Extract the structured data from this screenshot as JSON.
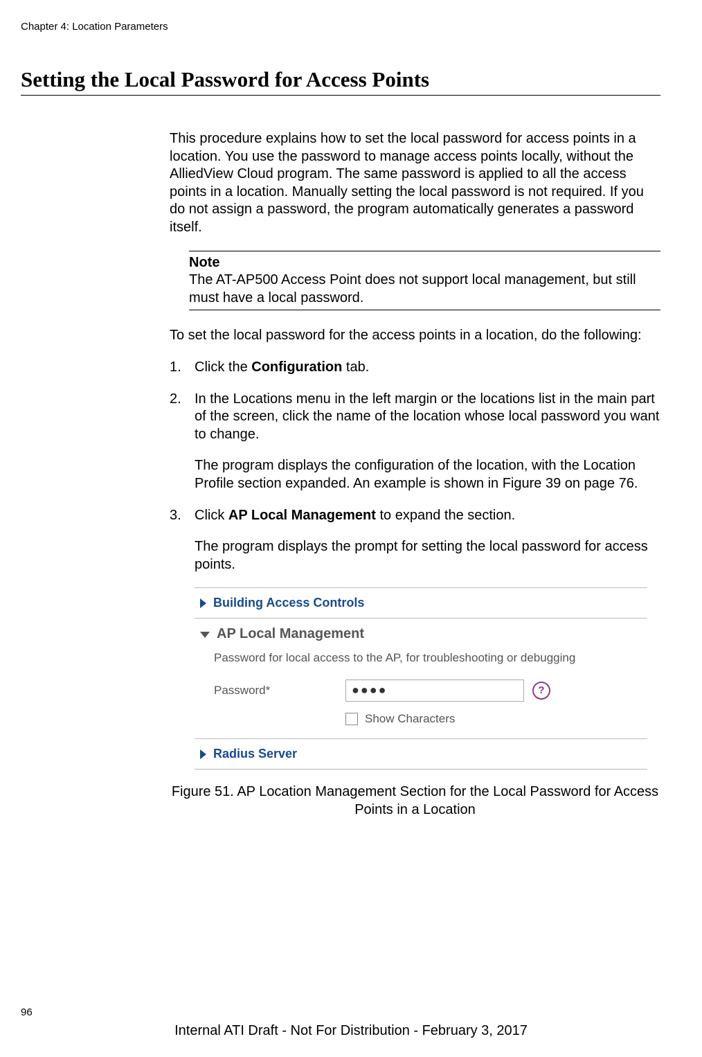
{
  "chapter": "Chapter 4: Location Parameters",
  "title": "Setting the Local Password for Access Points",
  "intro": "This procedure explains how to set the local password for access points in a location. You use the password to manage access points locally, without the AlliedView Cloud program. The same password is applied to all the access points in a location. Manually setting the local password is not required. If you do not assign a password, the program automatically generates a password itself.",
  "note": {
    "label": "Note",
    "text": "The AT-AP500 Access Point does not support local management, but still must have a local password."
  },
  "lead": "To set the local password for the access points in a location, do the following:",
  "steps": {
    "s1_pre": "Click the ",
    "s1_bold": "Configuration",
    "s1_post": " tab.",
    "s2": "In the Locations menu in the left margin or the locations list in the main part of the screen, click the name of the location whose local password you want to change.",
    "s2_sub": "The program displays the configuration of the location, with the Location Profile section expanded. An example is shown in Figure 39 on page 76.",
    "s3_pre": "Click ",
    "s3_bold": "AP Local Management",
    "s3_post": " to expand the section.",
    "s3_sub": "The program displays the prompt for setting the local password for access points."
  },
  "figure": {
    "row1": "Building Access Controls",
    "row2": "AP Local Management",
    "desc": "Password for local access to the AP, for troubleshooting or debugging",
    "pw_label": "Password*",
    "pw_value": "●●●●",
    "help": "?",
    "show_chars": "Show Characters",
    "row3": "Radius Server"
  },
  "caption": "Figure 51. AP Location Management Section for the Local Password for Access Points in a Location",
  "pagenum": "96",
  "footer": "Internal ATI Draft - Not For Distribution - February 3, 2017"
}
